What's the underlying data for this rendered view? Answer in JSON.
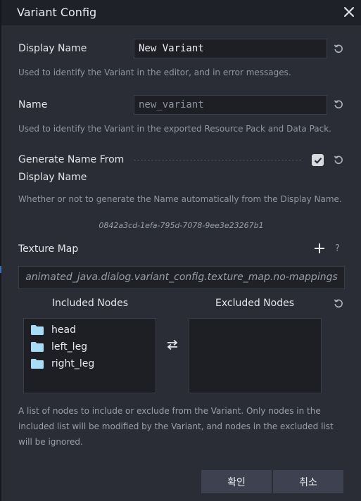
{
  "dialog": {
    "title": "Variant Config"
  },
  "display_name": {
    "label": "Display Name",
    "value": "New Variant",
    "description": "Used to identify the Variant in the editor, and in error messages."
  },
  "name": {
    "label": "Name",
    "value": "new_variant",
    "description": "Used to identify the Variant in the exported Resource Pack and Data Pack."
  },
  "generate_name": {
    "label_line1": "Generate Name From",
    "label_line2": "Display Name",
    "checked": true,
    "description": "Whether or not to generate the Name automatically from the Display Name."
  },
  "uuid": "0842a3cd-1efa-795d-7078-9ee3e23267b1",
  "texture_map": {
    "label": "Texture Map",
    "help": "?",
    "empty_text": "animated_java.dialog.variant_config.texture_map.no-mappings"
  },
  "nodes": {
    "included_header": "Included Nodes",
    "excluded_header": "Excluded Nodes",
    "included": [
      "head",
      "left_leg",
      "right_leg"
    ],
    "excluded": [],
    "description": "A list of nodes to include or exclude from the Variant. Only nodes in the included list will be modified by the Variant, and nodes in the excluded list will be ignored."
  },
  "buttons": {
    "confirm": "확인",
    "cancel": "취소"
  },
  "colors": {
    "folder": "#a8dcf4",
    "background": "#2a2d35",
    "titlebar": "#1f2128"
  }
}
